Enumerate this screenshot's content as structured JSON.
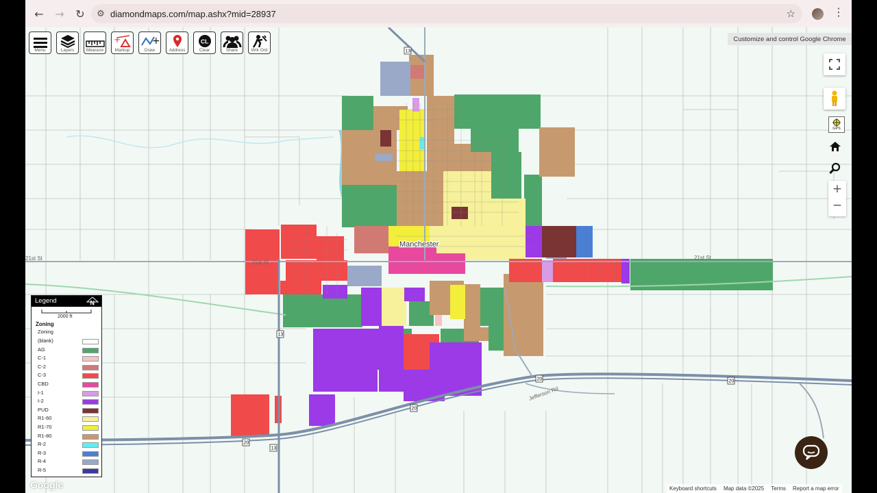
{
  "browser": {
    "url": "diamondmaps.com/map.ashx?mid=28937",
    "tooltip": "Customize and control Google Chrome"
  },
  "toolbar": [
    {
      "label": "Menu",
      "icon": "menu-icon"
    },
    {
      "label": "Layers",
      "icon": "layers-icon"
    },
    {
      "label": "Measure",
      "icon": "ruler-icon"
    },
    {
      "label": "Markup",
      "icon": "markup-icon"
    },
    {
      "label": "Draw",
      "icon": "draw-icon"
    },
    {
      "label": "Address",
      "icon": "map-pin-icon"
    },
    {
      "label": "Clear",
      "icon": "clear-icon"
    },
    {
      "label": "Share",
      "icon": "people-icon"
    },
    {
      "label": "Wrk Ord",
      "icon": "worker-icon"
    }
  ],
  "map": {
    "town_label": "Manchester",
    "road_labels": [
      "21st St",
      "21st St",
      "21st St",
      "Jefferson Rd"
    ],
    "highway_shields": [
      "13",
      "13",
      "13",
      "20",
      "20",
      "20",
      "20"
    ]
  },
  "controls": {
    "gps_label": "GPS"
  },
  "legend": {
    "title": "Legend",
    "scale_text": "2000 ft",
    "section_title": "Zoning",
    "sub_title": "Zoning",
    "items": [
      {
        "label": "(blank)",
        "color": "#ffffff"
      },
      {
        "label": "AG",
        "color": "#4fa66a"
      },
      {
        "label": "C-1",
        "color": "#f6c4c6"
      },
      {
        "label": "C-2",
        "color": "#d17a74"
      },
      {
        "label": "C-3",
        "color": "#f04a4a"
      },
      {
        "label": "CBD",
        "color": "#e8499e"
      },
      {
        "label": "I-1",
        "color": "#d89be6"
      },
      {
        "label": "I-2",
        "color": "#9b3ae6"
      },
      {
        "label": "PUD",
        "color": "#7a3434"
      },
      {
        "label": "R1-60",
        "color": "#f6f19a"
      },
      {
        "label": "R1-70",
        "color": "#f2ee3a"
      },
      {
        "label": "R1-80",
        "color": "#c69a6e"
      },
      {
        "label": "R-2",
        "color": "#5ef0f0"
      },
      {
        "label": "R-3",
        "color": "#4a7fd4"
      },
      {
        "label": "R-4",
        "color": "#9aa9c8"
      },
      {
        "label": "R-5",
        "color": "#3a3aa0"
      }
    ]
  },
  "attribution": {
    "google": "Google",
    "keyboard": "Keyboard shortcuts",
    "map_data": "Map data ©2025",
    "terms": "Terms",
    "report": "Report a map error"
  }
}
